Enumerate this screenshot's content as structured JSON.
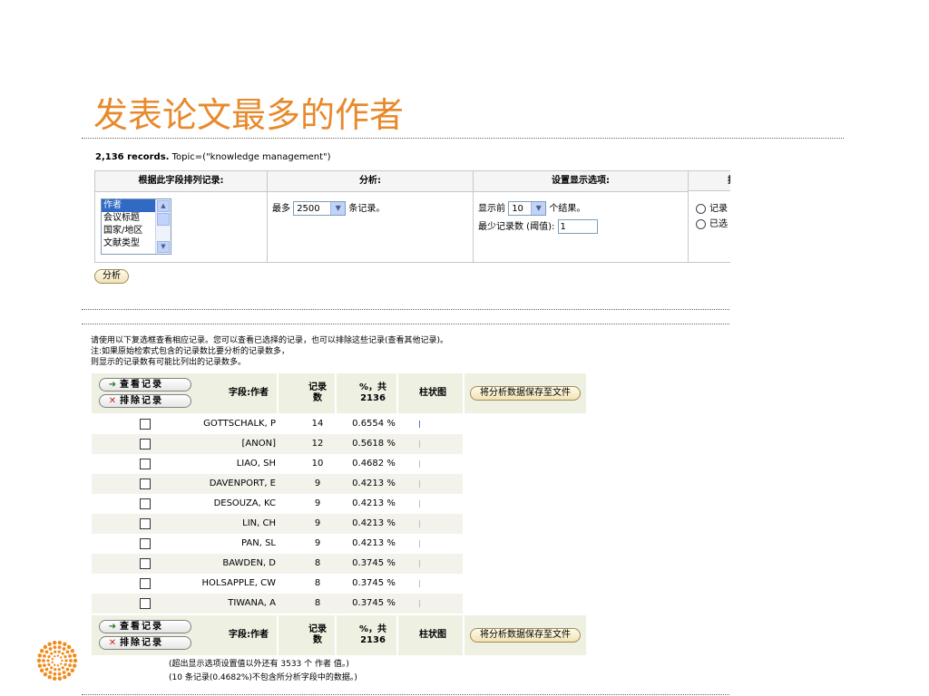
{
  "page_title": "发表论文最多的作者",
  "records": {
    "count": "2,136 records.",
    "query": " Topic=(\"knowledge management\")"
  },
  "form": {
    "headers": [
      "根据此字段排列记录:",
      "分析:",
      "设置显示选项:",
      "排"
    ],
    "field_list": [
      "作者",
      "会议标题",
      "国家/地区",
      "文献类型"
    ],
    "analyze_prefix": "最多",
    "analyze_value": "2500",
    "analyze_suffix": "条记录。",
    "show_prefix": "显示前",
    "show_value": "10",
    "show_suffix": "个结果。",
    "min_label": "最少记录数 (阈值):",
    "min_value": "1",
    "sort_options": [
      "记录",
      "已选"
    ],
    "analyze_button": "分析"
  },
  "instructions": [
    "请使用以下复选框查看相应记录。您可以查看已选择的记录，也可以排除这些记录(查看其他记录)。",
    "注:如果原始检索式包含的记录数比要分析的记录数多，",
    "则显示的记录数有可能比列出的记录数多。"
  ],
  "table": {
    "view_button": "查看记录",
    "exclude_button": "排除记录",
    "col_field": "字段:作者",
    "col_count": [
      "记录",
      "数"
    ],
    "col_pct": [
      "%，共",
      "2136"
    ],
    "col_bar": "柱状图",
    "save_button": "将分析数据保存至文件",
    "rows": [
      {
        "name": "GOTTSCHALK, P",
        "count": "14",
        "pct": "0.6554 %"
      },
      {
        "name": "[ANON]",
        "count": "12",
        "pct": "0.5618 %"
      },
      {
        "name": "LIAO, SH",
        "count": "10",
        "pct": "0.4682 %"
      },
      {
        "name": "DAVENPORT, E",
        "count": "9",
        "pct": "0.4213 %"
      },
      {
        "name": "DESOUZA, KC",
        "count": "9",
        "pct": "0.4213 %"
      },
      {
        "name": "LIN, CH",
        "count": "9",
        "pct": "0.4213 %"
      },
      {
        "name": "PAN, SL",
        "count": "9",
        "pct": "0.4213 %"
      },
      {
        "name": "BAWDEN, D",
        "count": "8",
        "pct": "0.3745 %"
      },
      {
        "name": "HOLSAPPLE, CW",
        "count": "8",
        "pct": "0.3745 %"
      },
      {
        "name": "TIWANA, A",
        "count": "8",
        "pct": "0.3745 %"
      }
    ]
  },
  "footer": [
    "(超出显示选项设置值以外还有  3533 个  作者  值。)",
    "(10 条记录(0.4682%)不包含所分析字段中的数据。)"
  ],
  "colors": {
    "title": "#e8892b",
    "logo": "#f08c1e",
    "header_bg": "#eef0e2"
  }
}
